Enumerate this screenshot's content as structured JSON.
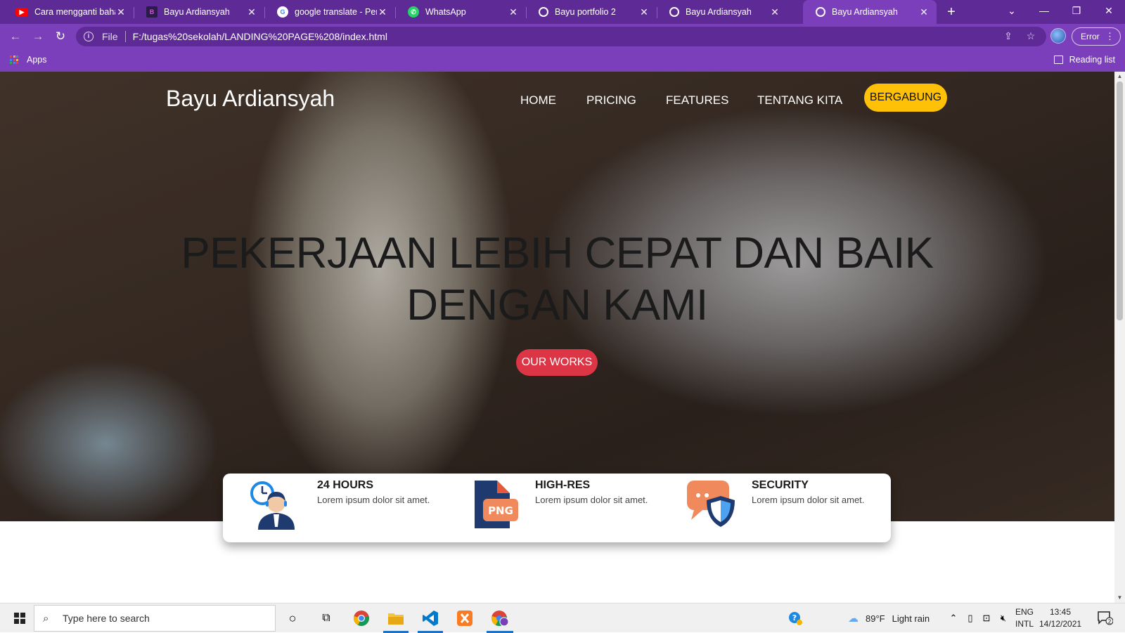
{
  "browser": {
    "tabs": [
      {
        "title": "Cara mengganti bahasa",
        "favicon": "youtube-icon",
        "active": false
      },
      {
        "title": "Bayu Ardiansyah",
        "favicon": "page-icon",
        "active": false
      },
      {
        "title": "google translate - Pene",
        "favicon": "google-icon",
        "active": false
      },
      {
        "title": "WhatsApp",
        "favicon": "whatsapp-icon",
        "active": false
      },
      {
        "title": "Bayu portfolio 2",
        "favicon": "globe-icon",
        "active": false
      },
      {
        "title": "Bayu Ardiansyah",
        "favicon": "globe-icon",
        "active": false
      },
      {
        "title": "Bayu Ardiansyah",
        "favicon": "globe-icon",
        "active": true
      }
    ],
    "new_tab": "+",
    "address": {
      "scheme_label": "File",
      "url": "F:/tugas%20sekolah/LANDING%20PAGE%208/index.html"
    },
    "profile_error_label": "Error",
    "bookmarks": {
      "apps_label": "Apps",
      "reading_list_label": "Reading list"
    },
    "colors": {
      "frame": "#5e2a96",
      "toolbar": "#7b3fbb"
    }
  },
  "page": {
    "brand": "Bayu Ardiansyah",
    "nav": [
      {
        "label": "HOME"
      },
      {
        "label": "PRICING"
      },
      {
        "label": "FEATURES"
      },
      {
        "label": "TENTANG KITA"
      }
    ],
    "join_label": "BERGABUNG",
    "headline_line1": "PEKERJAAN LEBIH CEPAT DAN BAIK",
    "headline_line2": "DENGAN KAMI",
    "cta_label": "OUR WORKS",
    "features": [
      {
        "title": "24 HOURS",
        "desc": "Lorem ipsum dolor sit amet.",
        "icon": "support-agent-clock-icon"
      },
      {
        "title": "HIGH-RES",
        "desc": "Lorem ipsum dolor sit amet.",
        "icon": "png-file-icon",
        "icon_text": "PNG"
      },
      {
        "title": "SECURITY",
        "desc": "Lorem ipsum dolor sit amet.",
        "icon": "chat-shield-icon"
      }
    ],
    "colors": {
      "join": "#ffc107",
      "cta": "#dc3545"
    }
  },
  "taskbar": {
    "search_placeholder": "Type here to search",
    "weather": {
      "temp": "89°F",
      "condition": "Light rain"
    },
    "language": {
      "line1": "ENG",
      "line2": "INTL"
    },
    "clock": {
      "time": "13:45",
      "date": "14/12/2021"
    },
    "notifications_count": "2"
  }
}
